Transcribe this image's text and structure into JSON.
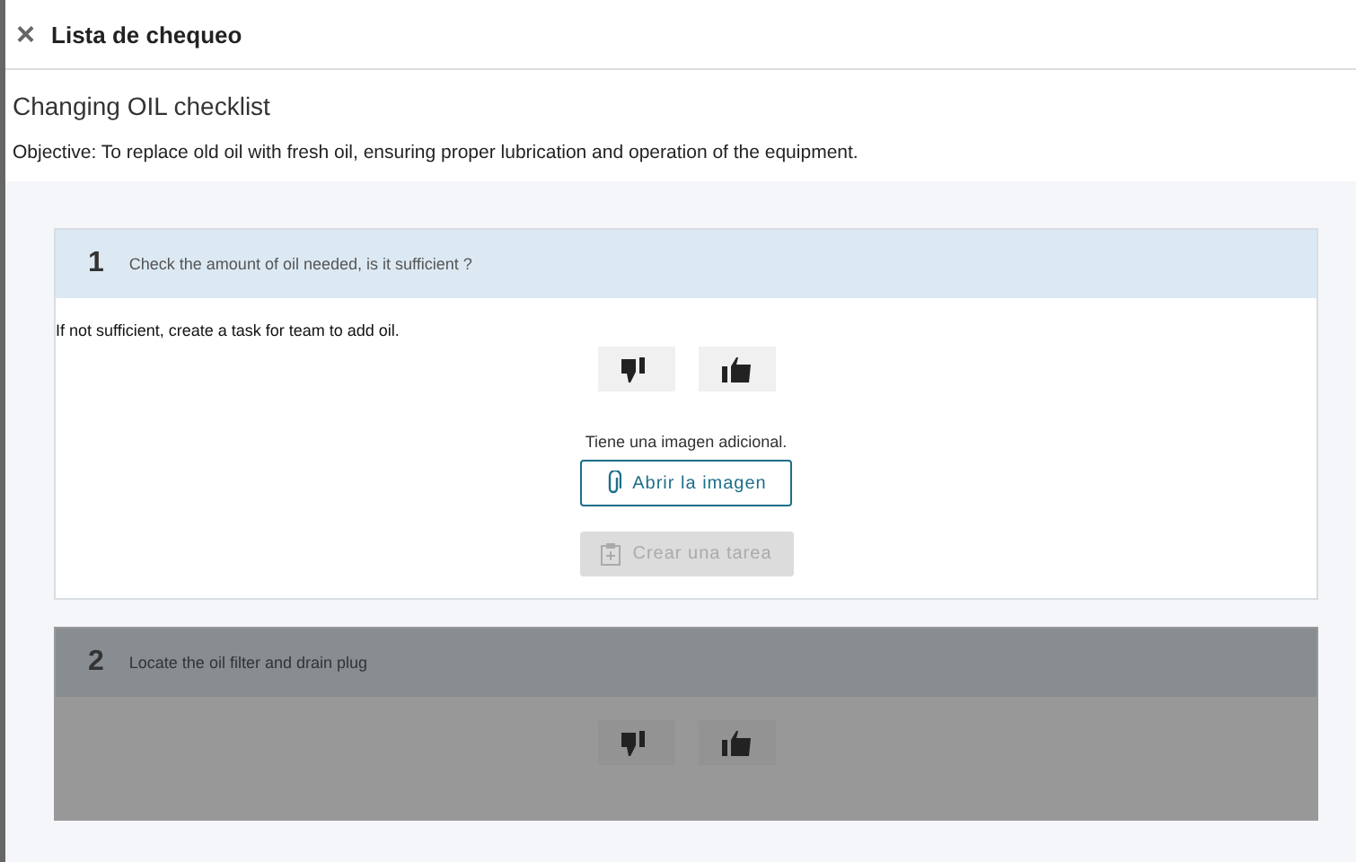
{
  "header": {
    "close_icon": "×",
    "title": "Lista de chequeo"
  },
  "checklist": {
    "title": "Changing OIL checklist",
    "objective": "Objective: To replace old oil with fresh oil, ensuring proper lubrication and operation of the equipment."
  },
  "items": [
    {
      "number": "1",
      "question": "Check the amount of oil needed, is it sufficient ?",
      "note": "If not sufficient, create a task for team to add oil.",
      "locked": false,
      "attachment_text": "Tiene una imagen adicional.",
      "open_button": "Abrir la imagen",
      "task_button": {
        "label": "Crear una tarea",
        "disabled": true
      }
    },
    {
      "number": "2",
      "question": "Locate the oil filter and drain plug",
      "locked": true
    }
  ]
}
